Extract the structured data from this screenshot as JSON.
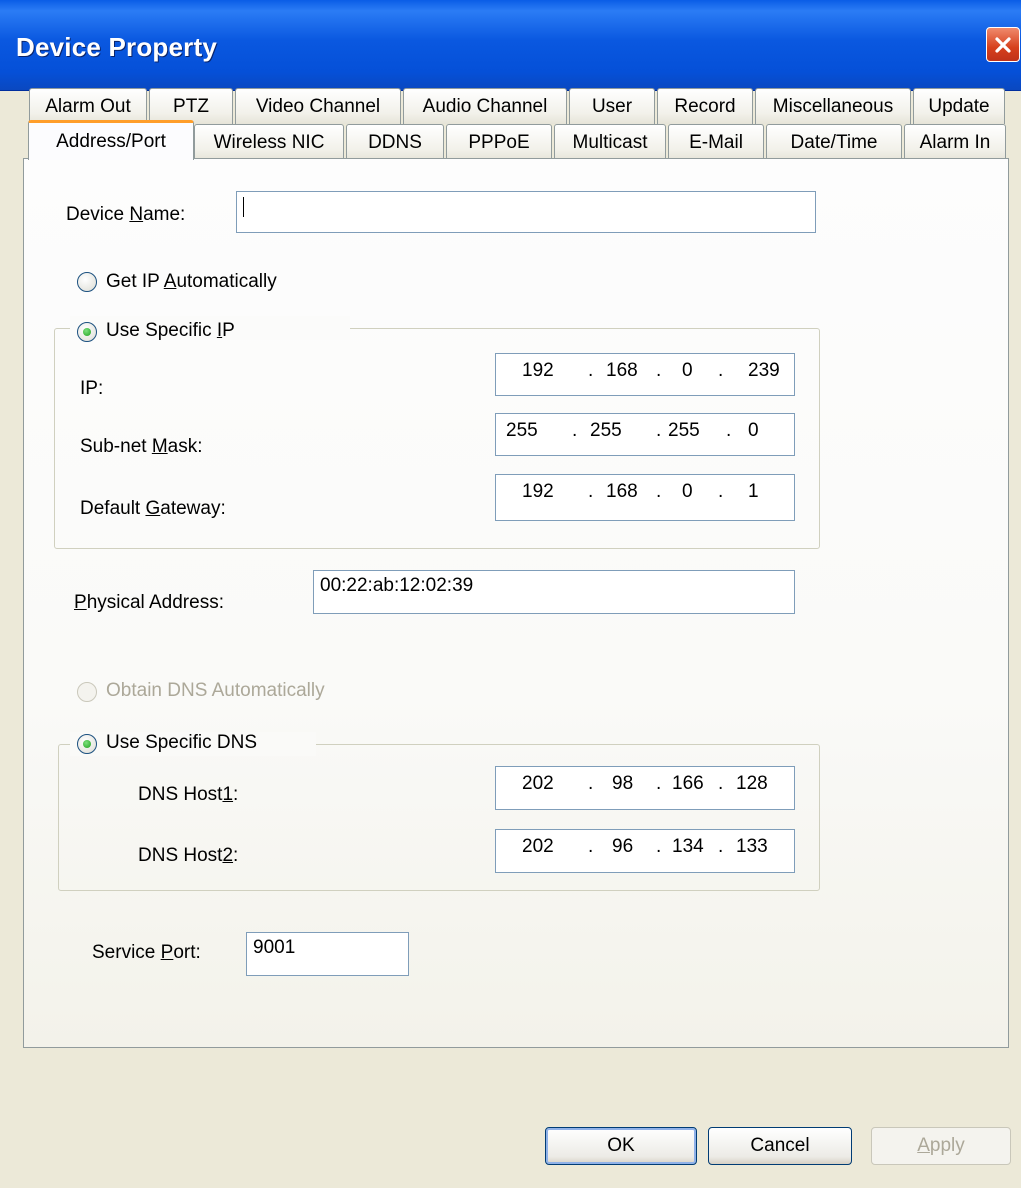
{
  "window": {
    "title": "Device Property"
  },
  "tabs_row1": [
    "Alarm Out",
    "PTZ",
    "Video Channel",
    "Audio Channel",
    "User",
    "Record",
    "Miscellaneous",
    "Update"
  ],
  "tabs_row2": [
    "Address/Port",
    "Wireless NIC",
    "DDNS",
    "PPPoE",
    "Multicast",
    "E-Mail",
    "Date/Time",
    "Alarm In"
  ],
  "active_tab": "Address/Port",
  "device_name": {
    "label_pre": "Device ",
    "label_key": "N",
    "label_post": "ame:",
    "value": ""
  },
  "ip_mode": {
    "auto_pre": "Get IP ",
    "auto_key": "A",
    "auto_post": "utomatically",
    "specific_pre": "Use Specific ",
    "specific_key": "I",
    "specific_post": "P",
    "selected": "Use Specific IP"
  },
  "ip": {
    "label": "IP:",
    "octets": [
      "192",
      "168",
      "0",
      "239"
    ]
  },
  "subnet": {
    "label_pre": "Sub-net ",
    "label_key": "M",
    "label_post": "ask:",
    "octets": [
      "255",
      "255",
      "255",
      "0"
    ]
  },
  "gateway": {
    "label_pre": "Default ",
    "label_key": "G",
    "label_post": "ateway:",
    "octets": [
      "192",
      "168",
      "0",
      "1"
    ]
  },
  "physical": {
    "label_key": "P",
    "label_post": "hysical Address:",
    "value": "00:22:ab:12:02:39"
  },
  "dns_mode": {
    "auto": "Obtain DNS Automatically",
    "specific": "Use Specific DNS",
    "selected": "Use Specific DNS"
  },
  "dns1": {
    "label_pre": "DNS Host",
    "label_key": "1",
    "label_post": ":",
    "octets": [
      "202",
      "98",
      "166",
      "128"
    ]
  },
  "dns2": {
    "label_pre": "DNS Host",
    "label_key": "2",
    "label_post": ":",
    "octets": [
      "202",
      "96",
      "134",
      "133"
    ]
  },
  "service_port": {
    "label_pre": "Service ",
    "label_key": "P",
    "label_post": "ort:",
    "value": "9001"
  },
  "buttons": {
    "ok": "OK",
    "cancel": "Cancel",
    "apply_key": "A",
    "apply_post": "pply"
  },
  "colors": {
    "title_bar": "#0a58e0",
    "active_tab_accent": "#ff9e2a",
    "close_button": "#d6401c"
  },
  "icons": {
    "close": "close-icon"
  }
}
